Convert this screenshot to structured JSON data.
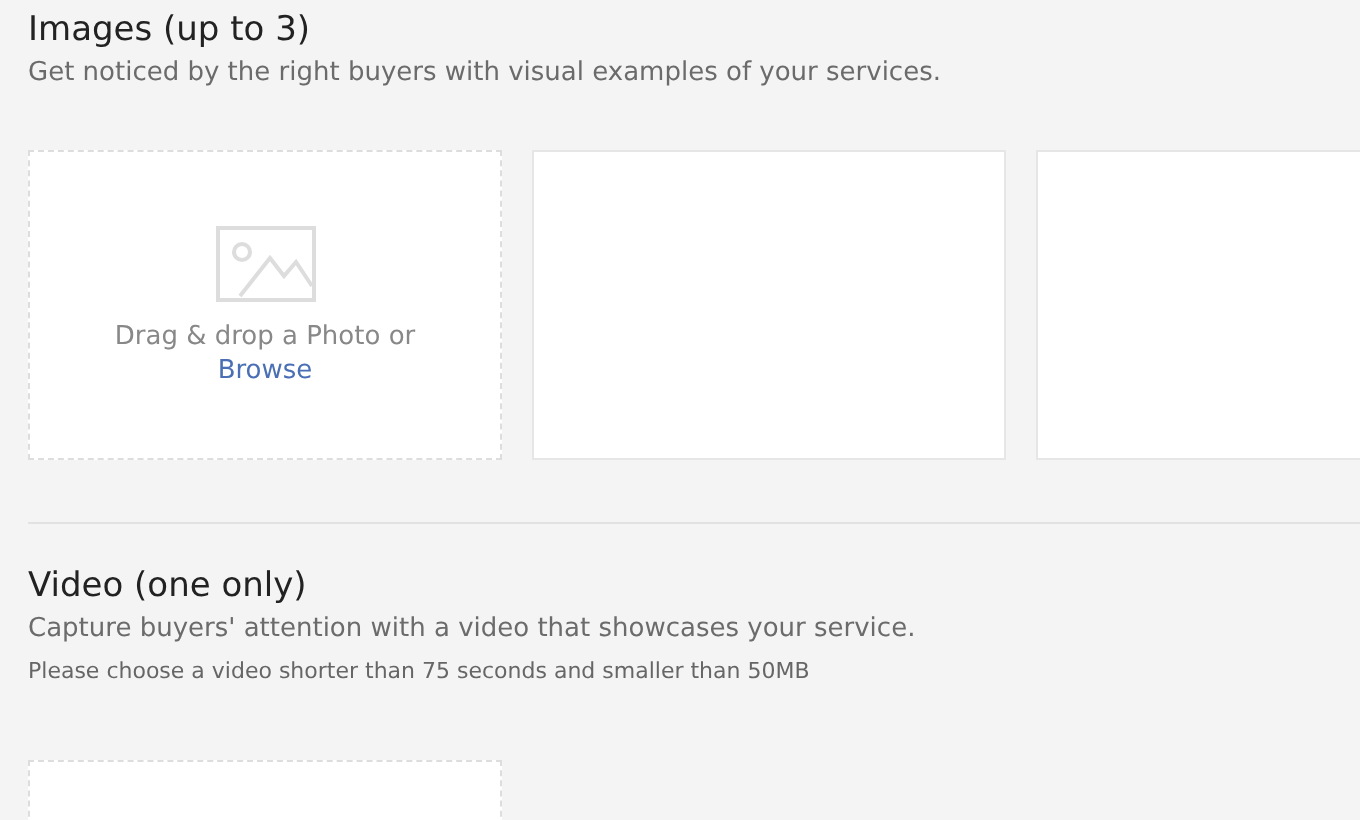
{
  "images": {
    "title": "Images (up to 3)",
    "subtitle": "Get noticed by the right buyers with visual examples of your services.",
    "slots": [
      {
        "kind": "dropzone",
        "prompt": "Drag & drop a Photo or",
        "link": "Browse"
      },
      {
        "kind": "empty"
      },
      {
        "kind": "empty"
      }
    ]
  },
  "video": {
    "title": "Video (one only)",
    "subtitle": "Capture buyers' attention with a video that showcases your service.",
    "note": "Please choose a video shorter than 75 seconds and smaller than 50MB",
    "slots": [
      {
        "kind": "empty-dashed"
      }
    ]
  }
}
